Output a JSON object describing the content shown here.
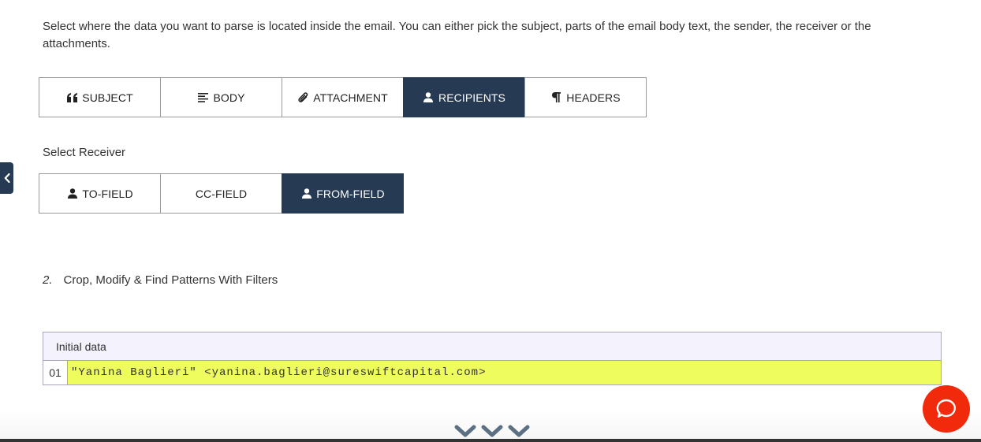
{
  "intro_text": "Select where the data you want to parse is located inside the email. You can either pick the subject, parts of the email body text, the sender, the receiver or the attachments.",
  "source_tabs": [
    {
      "label": "SUBJECT",
      "icon": "quote-icon",
      "active": false
    },
    {
      "label": "BODY",
      "icon": "text-align-icon",
      "active": false
    },
    {
      "label": "ATTACHMENT",
      "icon": "paperclip-icon",
      "active": false
    },
    {
      "label": "RECIPIENTS",
      "icon": "user-icon",
      "active": true
    },
    {
      "label": "HEADERS",
      "icon": "paragraph-icon",
      "active": false
    }
  ],
  "receiver_label": "Select Receiver",
  "receiver_tabs": [
    {
      "label": "TO-FIELD",
      "icon": "user-icon",
      "active": false
    },
    {
      "label": "CC-FIELD",
      "icon": "",
      "active": false
    },
    {
      "label": "FROM-FIELD",
      "icon": "user-icon",
      "active": true
    }
  ],
  "step": {
    "number": "2.",
    "title": "Crop, Modify & Find Patterns With Filters"
  },
  "data_table": {
    "header": "Initial data",
    "rows": [
      {
        "line": "01",
        "value": "\"Yanina Baglieri\" <yanina.baglieri@sureswiftcapital.com>"
      }
    ]
  },
  "colors": {
    "active": "#263a53",
    "highlight": "#eefc5d",
    "chat": "#f22a0c"
  }
}
